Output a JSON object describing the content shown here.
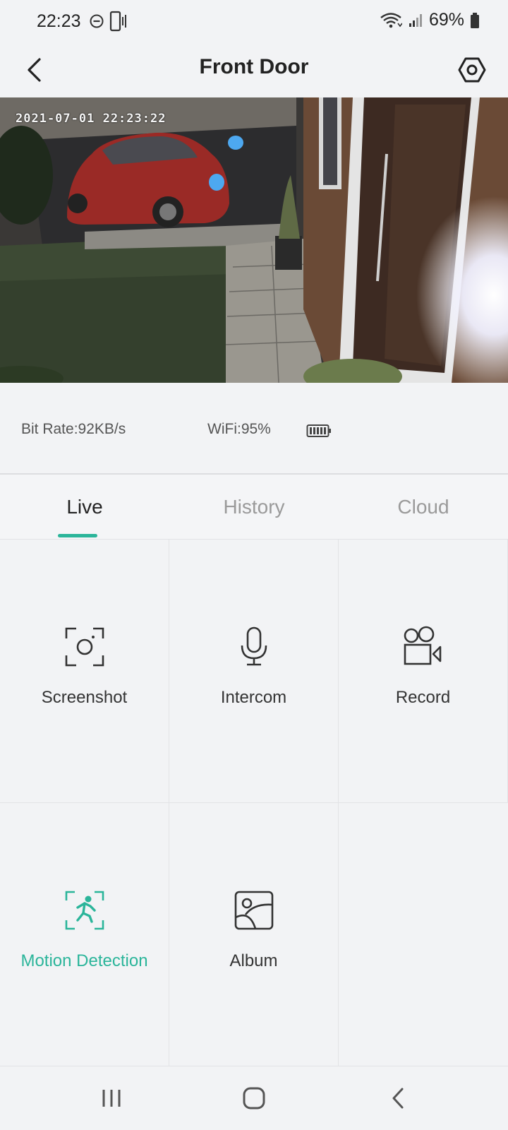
{
  "status_bar": {
    "time": "22:23",
    "battery_percent": "69%",
    "icons": [
      "do-not-disturb-icon",
      "phone-vibrate-icon",
      "wifi-icon",
      "cell-signal-icon",
      "battery-icon"
    ]
  },
  "header": {
    "title": "Front Door",
    "back_icon": "chevron-left-icon",
    "settings_icon": "hex-settings-icon"
  },
  "camera": {
    "timestamp": "2021-07-01 22:23:22"
  },
  "info": {
    "bitrate": "Bit Rate:92KB/s",
    "wifi": "WiFi:95%",
    "battery_icon": "device-battery-full-icon"
  },
  "tabs": [
    {
      "label": "Live",
      "active": true
    },
    {
      "label": "History",
      "active": false
    },
    {
      "label": "Cloud",
      "active": false
    }
  ],
  "actions": [
    {
      "label": "Screenshot",
      "icon": "screenshot-icon",
      "active": false
    },
    {
      "label": "Intercom",
      "icon": "microphone-icon",
      "active": false
    },
    {
      "label": "Record",
      "icon": "video-record-icon",
      "active": false
    },
    {
      "label": "Motion Detection",
      "icon": "motion-detection-icon",
      "active": true
    },
    {
      "label": "Album",
      "icon": "album-icon",
      "active": false
    }
  ],
  "nav_bar": {
    "icons": [
      "recent-apps-icon",
      "home-icon",
      "nav-back-icon"
    ]
  },
  "colors": {
    "accent": "#2bb59a",
    "background": "#f2f3f5",
    "text": "#222222",
    "muted": "#9a9a9a"
  }
}
